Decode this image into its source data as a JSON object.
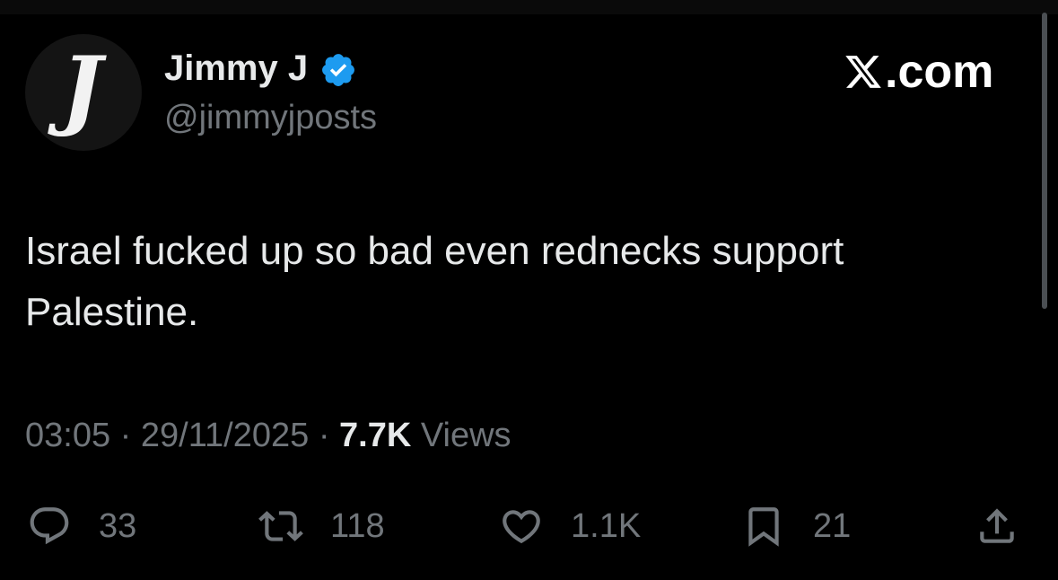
{
  "account": {
    "display_name": "Jimmy J",
    "handle": "@jimmyjposts",
    "avatar_letter": "J",
    "verified_color": "#1d9bf0"
  },
  "brand": {
    "text": ".com",
    "icon": "x-logo-icon"
  },
  "tweet": {
    "text": "Israel fucked up so bad even rednecks support Palestine."
  },
  "meta": {
    "time": "03:05",
    "separator": "·",
    "date": "29/11/2025",
    "views_count": "7.7K",
    "views_label": "Views"
  },
  "actions": {
    "replies": "33",
    "reposts": "118",
    "likes": "1.1K",
    "bookmarks": "21"
  },
  "icons": {
    "reply": "reply-icon",
    "repost": "repost-icon",
    "like": "heart-icon",
    "bookmark": "bookmark-icon",
    "share": "share-icon"
  },
  "colors": {
    "background": "#000000",
    "text": "#e7e9ea",
    "muted": "#71767b"
  }
}
